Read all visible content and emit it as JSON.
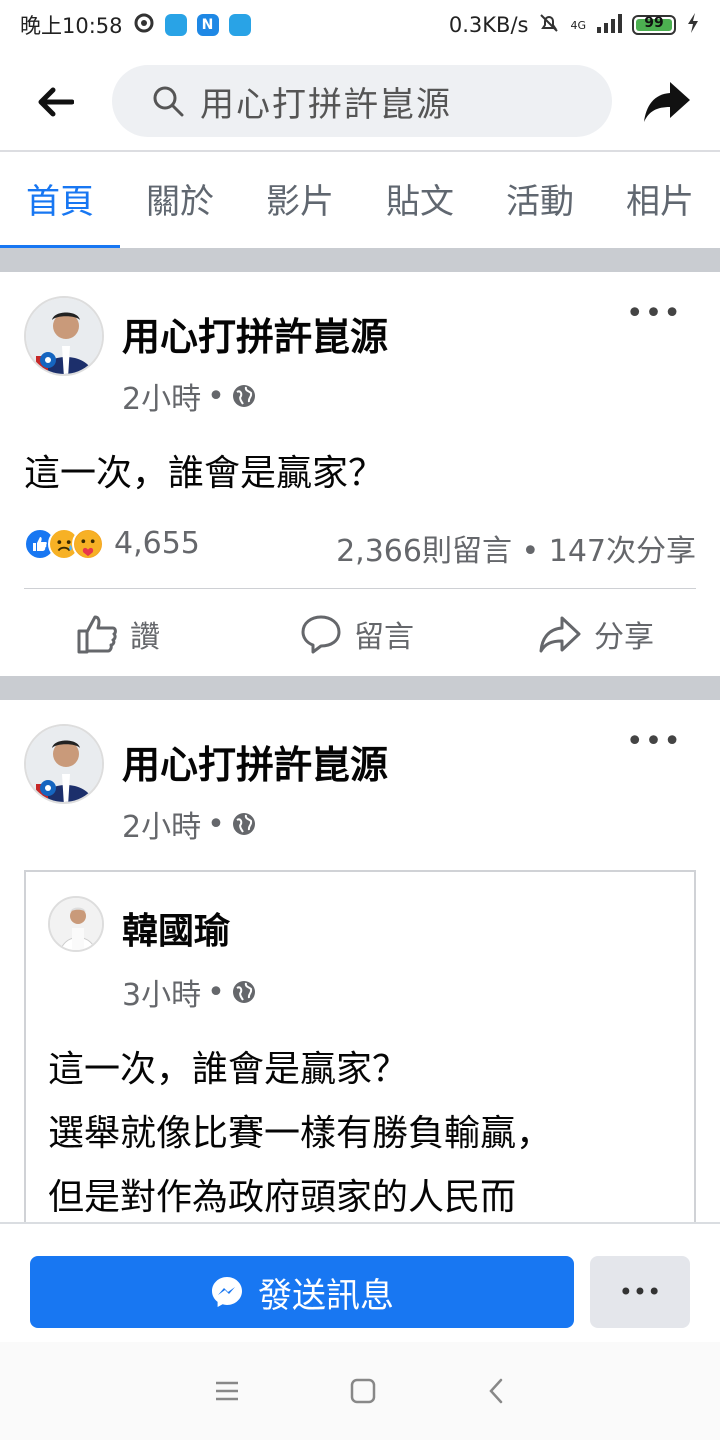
{
  "status_bar": {
    "time": "晚上10:58",
    "speed": "0.3KB/s",
    "network": "4G",
    "battery": "99",
    "battery_level": 0.99,
    "app_icon_letter": "N"
  },
  "header": {
    "search_text": "用心打拼許崑源"
  },
  "tabs": [
    {
      "label": "首頁"
    },
    {
      "label": "關於"
    },
    {
      "label": "影片"
    },
    {
      "label": "貼文"
    },
    {
      "label": "活動"
    },
    {
      "label": "相片"
    }
  ],
  "post1": {
    "author": "用心打拼許崑源",
    "time": "2小時",
    "dot": "•",
    "more": "•••",
    "text": "這一次，誰會是贏家？",
    "reaction_count": "4,655",
    "stats": "2,366則留言 • 147次分享",
    "actions": {
      "like": "讚",
      "comment": "留言",
      "share": "分享"
    }
  },
  "post2": {
    "author": "用心打拼許崑源",
    "time": "2小時",
    "dot": "•",
    "more": "•••",
    "shared": {
      "author": "韓國瑜",
      "time": "3小時",
      "dot": "•",
      "lines": [
        "這一次，誰會是贏家？",
        "選舉就像比賽一樣有勝負輸贏，",
        "但是對作為政府頭家的人民而"
      ]
    }
  },
  "bottom_bar": {
    "message_button": "發送訊息",
    "more_button": "•••"
  },
  "colors": {
    "accent": "#1877f2",
    "secondary_text": "#65676b",
    "separator": "#c9ccd1"
  }
}
